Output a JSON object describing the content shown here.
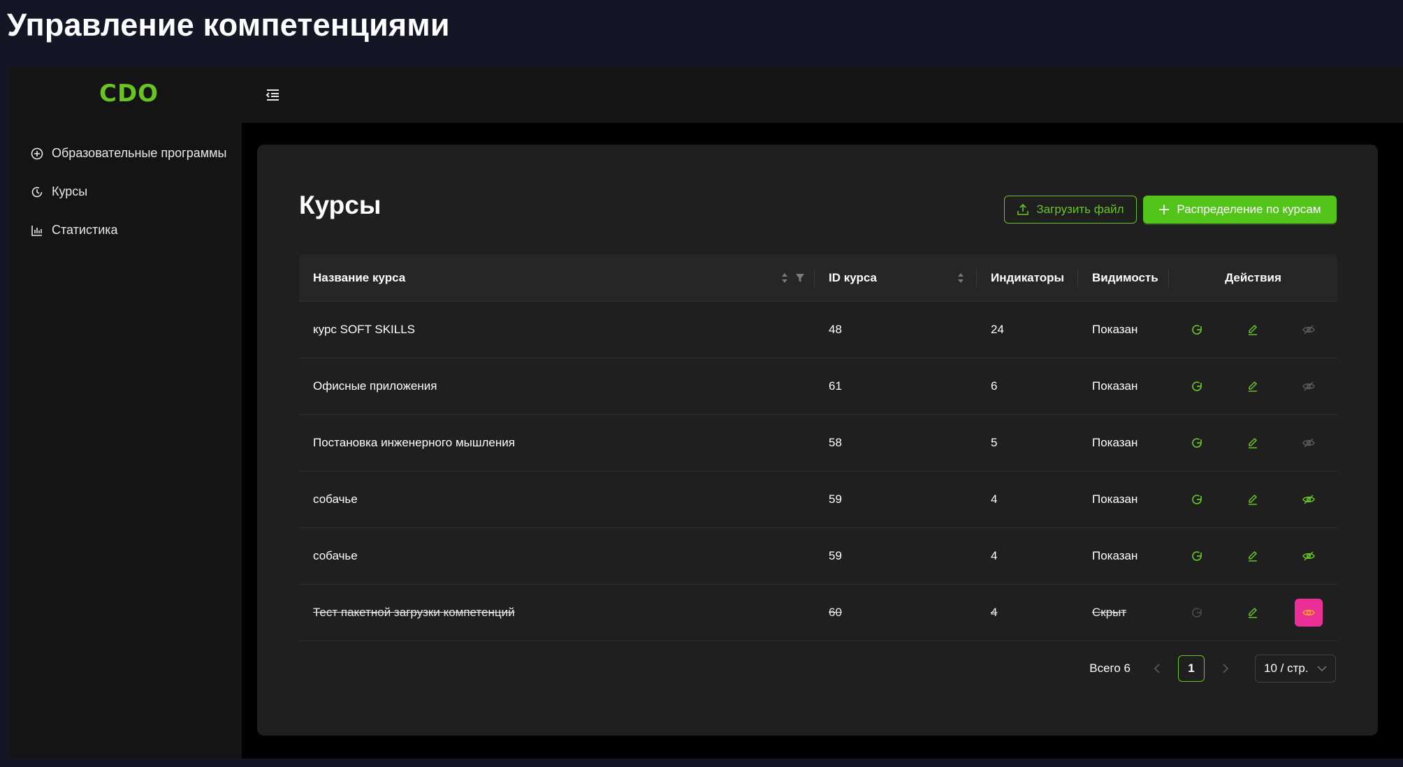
{
  "page_heading": "Управление компетенциями",
  "header": {
    "logo": "CDO"
  },
  "sidebar": {
    "items": [
      {
        "label": "Образовательные программы",
        "icon": "plus-circle-icon"
      },
      {
        "label": "Курсы",
        "icon": "clock-icon"
      },
      {
        "label": "Статистика",
        "icon": "bar-chart-icon"
      }
    ]
  },
  "main": {
    "title": "Курсы",
    "upload_label": "Загрузить файл",
    "distribute_label": "Распределение по курсам",
    "columns": {
      "name": "Название курса",
      "id": "ID курса",
      "indicators": "Индикаторы",
      "visibility": "Видимость",
      "actions": "Действия"
    },
    "rows": [
      {
        "name": "курс SOFT SKILLS",
        "id": "48",
        "indicators": "24",
        "visibility": "Показан"
      },
      {
        "name": "Офисные приложения",
        "id": "61",
        "indicators": "6",
        "visibility": "Показан"
      },
      {
        "name": "Постановка инженерного мышления",
        "id": "58",
        "indicators": "5",
        "visibility": "Показан"
      },
      {
        "name": "собачье",
        "id": "59",
        "indicators": "4",
        "visibility": "Показан"
      },
      {
        "name": "собачье",
        "id": "59",
        "indicators": "4",
        "visibility": "Показан"
      },
      {
        "name": "Тест пакетной загрузки компетенций",
        "id": "60",
        "indicators": "4",
        "visibility": "Скрыт"
      }
    ],
    "pagination": {
      "total": "Всего 6",
      "current_page": "1",
      "page_size": "10 / стр."
    }
  },
  "colors": {
    "accent": "#67c423",
    "primary_button": "#52c41a",
    "danger": "#eb2f96",
    "background": "#141625"
  }
}
